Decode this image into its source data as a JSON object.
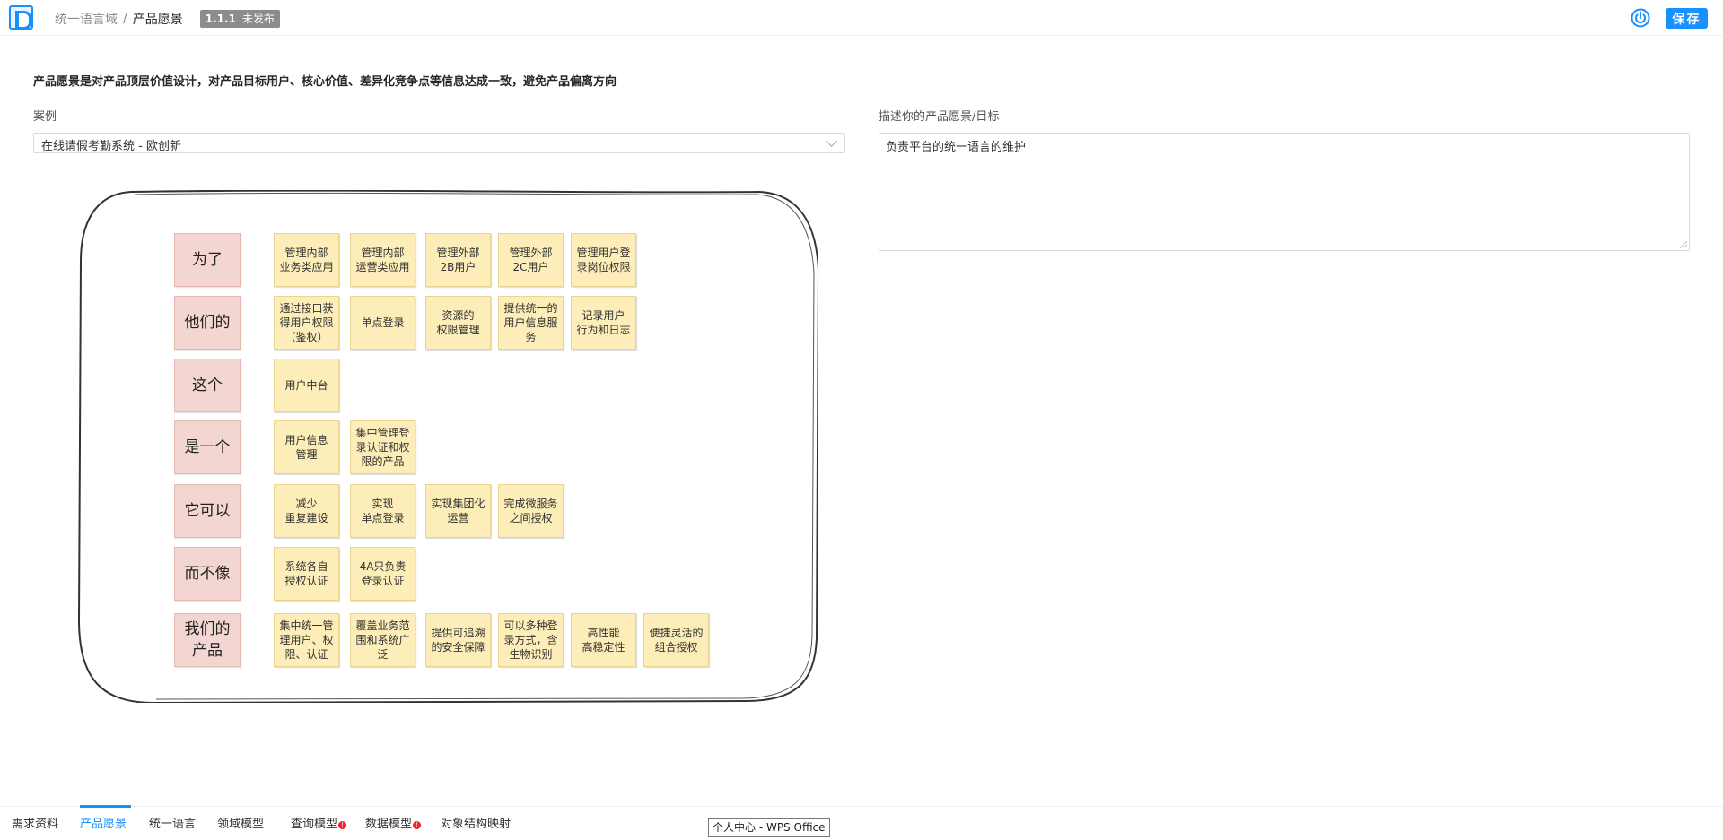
{
  "header": {
    "breadcrumb_parent": "统一语言域",
    "breadcrumb_sep": "/",
    "breadcrumb_current": "产品愿景",
    "version": "1.1.1",
    "status": "未发布",
    "save_label": "保存"
  },
  "intro": "产品愿景是对产品顶层价值设计，对产品目标用户、核心价值、差异化竞争点等信息达成一致，避免产品偏离方向",
  "case": {
    "label": "案例",
    "selected": "在线请假考勤系统 - 欧创新"
  },
  "vision": {
    "label": "描述你的产品愿景/目标",
    "value": "负责平台的统一语言的维护"
  },
  "board": {
    "rows": [
      {
        "label": "为了",
        "notes": [
          "管理内部\n业务类应用",
          "管理内部\n运营类应用",
          "管理外部\n2B用户",
          "管理外部\n2C用户",
          "管理用户登\n录岗位权限"
        ]
      },
      {
        "label": "他们的",
        "notes": [
          "通过接口获\n得用户权限\n（鉴权）",
          "单点登录",
          "资源的\n权限管理",
          "提供统一的\n用户信息服\n务",
          "记录用户\n行为和日志"
        ]
      },
      {
        "label": "这个",
        "notes": [
          "用户中台"
        ]
      },
      {
        "label": "是一个",
        "notes": [
          "用户信息\n管理",
          "集中管理登\n录认证和权\n限的产品"
        ]
      },
      {
        "label": "它可以",
        "notes": [
          "减少\n重复建设",
          "实现\n单点登录",
          "实现集团化\n运营",
          "完成微服务\n之间授权"
        ]
      },
      {
        "label": "而不像",
        "notes": [
          "系统各自\n授权认证",
          "4A只负责\n登录认证"
        ]
      },
      {
        "label": "我们的\n产品",
        "notes": [
          "集中统一管\n理用户、权\n限、认证",
          "覆盖业务范\n围和系统广\n泛",
          "提供可追溯\n的安全保障",
          "可以多种登\n录方式，含\n生物识别",
          "高性能\n高稳定性",
          "便捷灵活的\n组合授权"
        ]
      }
    ]
  },
  "tabs": [
    {
      "label": "需求资料"
    },
    {
      "label": "产品愿景",
      "active": true
    },
    {
      "label": "统一语言"
    },
    {
      "label": "领域模型"
    },
    {
      "label": "查询模型",
      "badge": "!"
    },
    {
      "label": "数据模型",
      "badge": "!"
    },
    {
      "label": "对象结构映射"
    }
  ],
  "taskbar_popup": "个人中心 - WPS Office",
  "colors": {
    "accent": "#1890ff",
    "row_label": "#f3d6d1",
    "sticky_note": "#fdedb8"
  }
}
